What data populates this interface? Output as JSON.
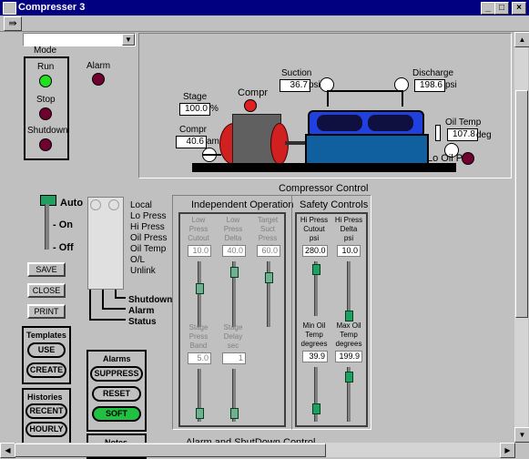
{
  "window": {
    "title": "Compresser 3",
    "min": "_",
    "max": "□",
    "close": "×"
  },
  "toolbar": {
    "arrow_btn": "⇛"
  },
  "dropdown": {
    "value": ""
  },
  "mode": {
    "heading": "Mode",
    "run": "Run",
    "stop": "Stop",
    "shutdown": "Shutdown",
    "alarm": "Alarm"
  },
  "schematic": {
    "stage_label": "Stage",
    "stage_value": "100.0",
    "stage_unit": "%",
    "compr_label": "Compr",
    "compr_amp_label": "Compr",
    "compr_amp_value": "40.6",
    "compr_amp_unit": "amp",
    "suction_label": "Suction",
    "suction_value": "36.7",
    "suction_unit": "psi",
    "discharge_label": "Discharge",
    "discharge_value": "198.6",
    "discharge_unit": "psi",
    "oiltemp_label": "Oil Temp",
    "oiltemp_value": "107.8",
    "oiltemp_unit": "deg",
    "lo_oil_label": "Lo Oil P",
    "caption": "Compressor Control"
  },
  "status_panel": {
    "auto": "Auto",
    "on": "- On",
    "off": "- Off",
    "indicators": [
      "Local",
      "Lo Press",
      "Hi Press",
      "Oil Press",
      "Oil Temp",
      "O/L",
      "Unlink"
    ],
    "shutdown": "Shutdown",
    "alarm": "Alarm",
    "status": "Status"
  },
  "buttons": {
    "save": "SAVE",
    "close": "CLOSE",
    "print": "PRINT"
  },
  "templates": {
    "heading": "Templates",
    "use": "USE",
    "create": "CREATE"
  },
  "histories": {
    "heading": "Histories",
    "recent": "RECENT",
    "hourly": "HOURLY"
  },
  "alarms": {
    "heading": "Alarms",
    "suppress": "SUPPRESS",
    "reset": "RESET",
    "soft": "SOFT"
  },
  "notes": {
    "heading": "Notes"
  },
  "independent": {
    "heading": "Independent Operation",
    "cols": [
      {
        "label": "Low Press\nCutout\npsi",
        "value": "10.0",
        "thumb_frac": 0.4
      },
      {
        "label": "Low Press\nDelta\npsi",
        "value": "40.0",
        "thumb_frac": 0.1
      },
      {
        "label": "Target\nSuct Press\npsi",
        "value": "60.0",
        "thumb_frac": 0.2
      }
    ],
    "cols2": [
      {
        "label": "Stage\nPress Band\npsi",
        "value": "5.0",
        "thumb_frac": 0.9
      },
      {
        "label": "Stage\nDelay\nsec",
        "value": "1",
        "thumb_frac": 0.9
      }
    ]
  },
  "safety": {
    "heading": "Safety Controls",
    "cols": [
      {
        "label": "Hi Press\nCutout\npsi",
        "value": "280.0",
        "thumb_frac": 0.05
      },
      {
        "label": "Hi Press\nDelta\npsi",
        "value": "10.0",
        "thumb_frac": 0.9
      }
    ],
    "cols2": [
      {
        "label": "Min Oil\nTemp\ndegrees",
        "value": "39.9",
        "thumb_frac": 0.8
      },
      {
        "label": "Max Oil\nTemp\ndegrees",
        "value": "199.9",
        "thumb_frac": 0.1
      }
    ]
  },
  "alarm_shutdown_caption": "Alarm and ShutDown Control"
}
